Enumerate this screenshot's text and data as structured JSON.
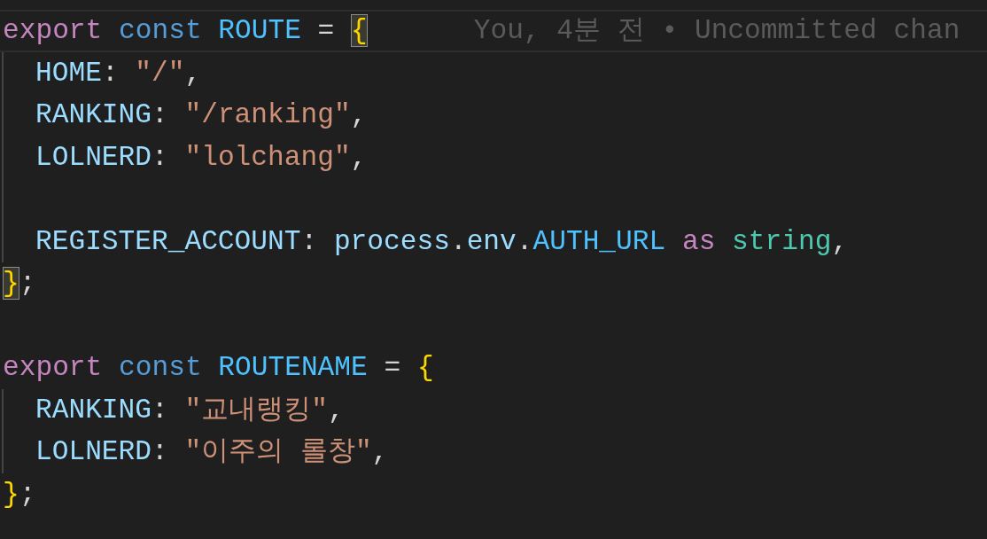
{
  "editor": {
    "lines": [
      {
        "current": true,
        "guide": false,
        "blame": "You, 4분 전 • Uncommitted chan",
        "tokens": [
          {
            "text": "export",
            "kind": "keyword"
          },
          {
            "text": "const",
            "kind": "storage"
          },
          {
            "text": "ROUTE",
            "kind": "constant"
          },
          {
            "text": "=",
            "kind": "equals"
          },
          {
            "text": "{",
            "kind": "bracket",
            "matched": true
          }
        ]
      },
      {
        "current": false,
        "guide": true,
        "tokens": [
          {
            "text": "HOME",
            "kind": "property"
          },
          {
            "text": ":",
            "kind": "colon"
          },
          {
            "text": "\"/\"",
            "kind": "string"
          },
          {
            "text": ",",
            "kind": "comma"
          }
        ]
      },
      {
        "current": false,
        "guide": true,
        "tokens": [
          {
            "text": "RANKING",
            "kind": "property"
          },
          {
            "text": ":",
            "kind": "colon"
          },
          {
            "text": "\"/ranking\"",
            "kind": "string"
          },
          {
            "text": ",",
            "kind": "comma"
          }
        ]
      },
      {
        "current": false,
        "guide": true,
        "tokens": [
          {
            "text": "LOLNERD",
            "kind": "property"
          },
          {
            "text": ":",
            "kind": "colon"
          },
          {
            "text": "\"lolchang\"",
            "kind": "string"
          },
          {
            "text": ",",
            "kind": "comma"
          }
        ]
      },
      {
        "current": false,
        "guide": true
      },
      {
        "current": false,
        "guide": true,
        "tokens": [
          {
            "text": "REGISTER_ACCOUNT",
            "kind": "property"
          },
          {
            "text": ":",
            "kind": "colon"
          },
          {
            "text": "process",
            "kind": "variable"
          },
          {
            "text": ".",
            "kind": "dot"
          },
          {
            "text": "env",
            "kind": "variable"
          },
          {
            "text": ".",
            "kind": "dot"
          },
          {
            "text": "AUTH_URL",
            "kind": "constant"
          },
          {
            "text": "as",
            "kind": "keyword"
          },
          {
            "text": "string",
            "kind": "type"
          },
          {
            "text": ",",
            "kind": "comma"
          }
        ]
      },
      {
        "current": false,
        "guide": false,
        "tokens": [
          {
            "text": "}",
            "kind": "bracket",
            "matched": true
          },
          {
            "text": ";",
            "kind": "semicolon"
          }
        ]
      },
      {
        "current": false,
        "guide": false
      },
      {
        "current": false,
        "guide": false,
        "tokens": [
          {
            "text": "export",
            "kind": "keyword"
          },
          {
            "text": "const",
            "kind": "storage"
          },
          {
            "text": "ROUTENAME",
            "kind": "constant"
          },
          {
            "text": "=",
            "kind": "equals"
          },
          {
            "text": "{",
            "kind": "bracket",
            "matched": false
          }
        ]
      },
      {
        "current": false,
        "guide": true,
        "tokens": [
          {
            "text": "RANKING",
            "kind": "property"
          },
          {
            "text": ":",
            "kind": "colon"
          },
          {
            "text": "\"교내랭킹\"",
            "kind": "string"
          },
          {
            "text": ",",
            "kind": "comma"
          }
        ]
      },
      {
        "current": false,
        "guide": true,
        "tokens": [
          {
            "text": "LOLNERD",
            "kind": "property"
          },
          {
            "text": ":",
            "kind": "colon"
          },
          {
            "text": "\"이주의 롤창\"",
            "kind": "string"
          },
          {
            "text": ",",
            "kind": "comma"
          }
        ]
      },
      {
        "current": false,
        "guide": false,
        "tokens": [
          {
            "text": "}",
            "kind": "bracket",
            "matched": false
          },
          {
            "text": ";",
            "kind": "semicolon"
          }
        ]
      }
    ]
  }
}
